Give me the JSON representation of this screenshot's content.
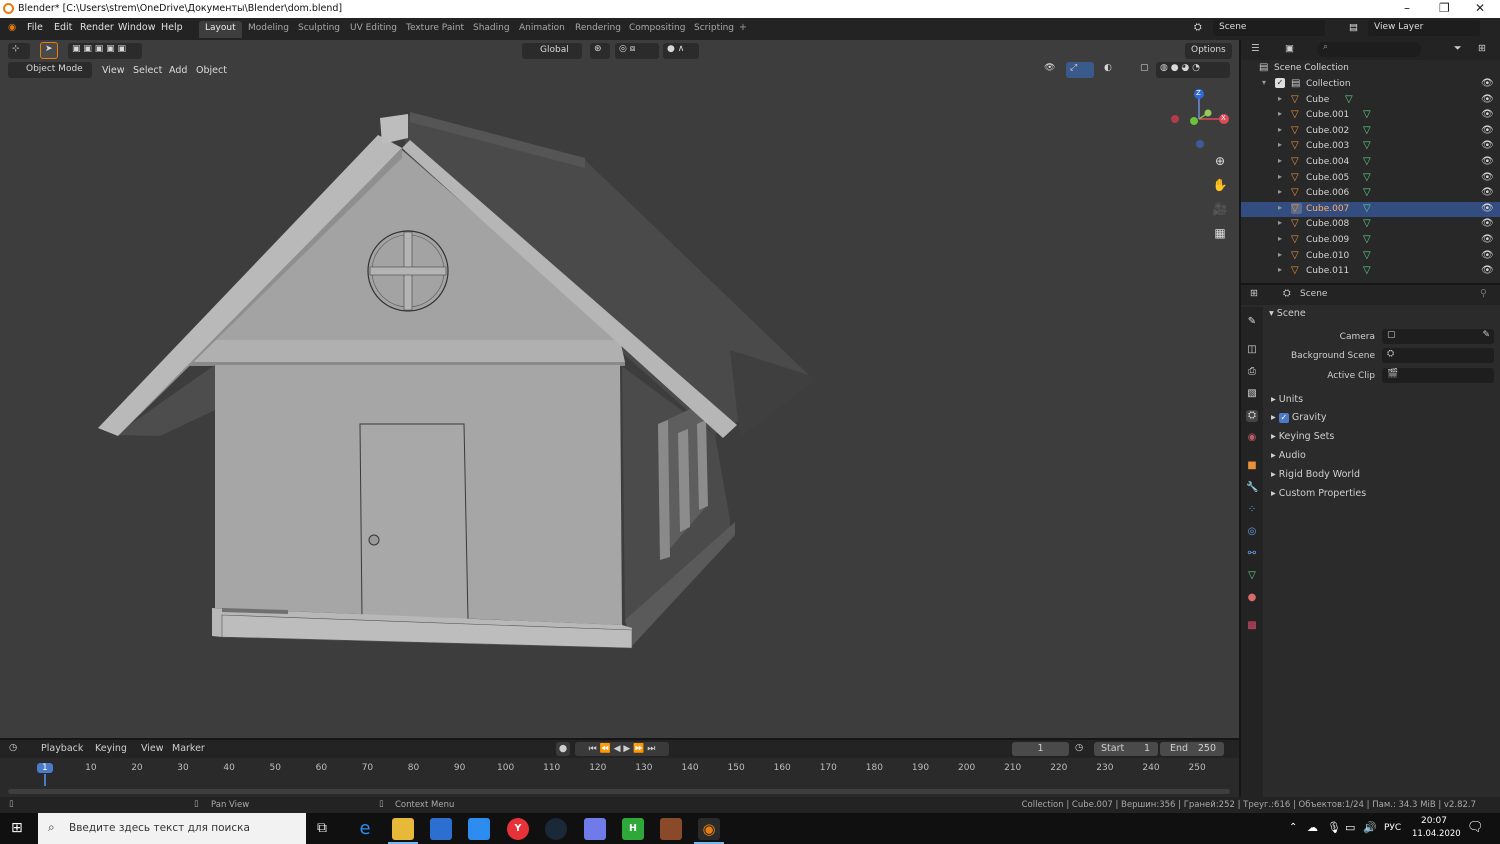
{
  "window": {
    "title": "Blender* [C:\\Users\\strem\\OneDrive\\Документы\\Blender\\dom.blend]"
  },
  "menu": [
    "File",
    "Edit",
    "Render",
    "Window",
    "Help"
  ],
  "workspaces": [
    "Layout",
    "Modeling",
    "Sculpting",
    "UV Editing",
    "Texture Paint",
    "Shading",
    "Animation",
    "Rendering",
    "Compositing",
    "Scripting"
  ],
  "scene_field": "Scene",
  "view_layer_field": "View Layer",
  "viewport": {
    "orientation": "Global",
    "options_label": "Options",
    "mode": "Object Mode",
    "menus": [
      "View",
      "Select",
      "Add",
      "Object"
    ],
    "gizmo": {
      "z": "Z",
      "x": "X"
    }
  },
  "outliner": {
    "root": "Scene Collection",
    "collection": "Collection",
    "objects": [
      "Cube",
      "Cube.001",
      "Cube.002",
      "Cube.003",
      "Cube.004",
      "Cube.005",
      "Cube.006",
      "Cube.007",
      "Cube.008",
      "Cube.009",
      "Cube.010",
      "Cube.011"
    ],
    "selected": "Cube.007"
  },
  "properties": {
    "context": "Scene",
    "panel_title": "Scene",
    "camera_label": "Camera",
    "background_scene_label": "Background Scene",
    "active_clip_label": "Active Clip",
    "sections": [
      "Units",
      "Gravity",
      "Keying Sets",
      "Audio",
      "Rigid Body World",
      "Custom Properties"
    ]
  },
  "timeline": {
    "menus": [
      "Playback",
      "Keying",
      "View",
      "Marker"
    ],
    "current_frame": "1",
    "start_label": "Start",
    "start_value": "1",
    "end_label": "End",
    "end_value": "250",
    "ticks": [
      "1",
      "10",
      "20",
      "30",
      "40",
      "50",
      "60",
      "70",
      "80",
      "90",
      "100",
      "110",
      "120",
      "130",
      "140",
      "150",
      "160",
      "170",
      "180",
      "190",
      "200",
      "210",
      "220",
      "230",
      "240",
      "250"
    ]
  },
  "status": {
    "pan_view": "Pan View",
    "context_menu": "Context Menu",
    "stats": "Collection | Cube.007 | Вершин:356 | Граней:252 | Треуг.:616 | Объектов:1/24 | Пам.: 34.3 MiB | v2.82.7"
  },
  "taskbar": {
    "search_placeholder": "Введите здесь текст для поиска",
    "language": "РУС",
    "time": "20:07",
    "date": "11.04.2020"
  },
  "colors": {
    "accent_orange": "#e87d0d",
    "selection_blue": "#334d80",
    "viewport_bg": "#3d3d3d"
  }
}
